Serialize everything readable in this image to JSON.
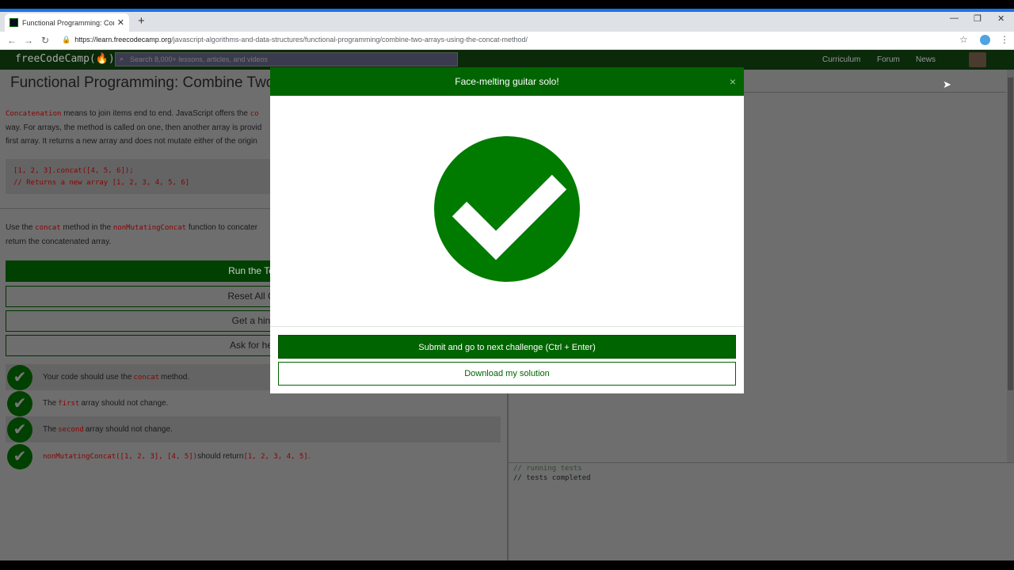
{
  "browser": {
    "tab_title": "Functional Programming: Combi",
    "tab_close": "✕",
    "new_tab": "+",
    "url_host": "https://learn.freecodecamp.org",
    "url_path": "/javascript-algorithms-and-data-structures/functional-programming/combine-two-arrays-using-the-concat-method/"
  },
  "fcc_nav": {
    "logo": "freeCodeCamp(🔥)",
    "search_placeholder": "Search 8,000+ lessons, articles, and videos",
    "links": [
      "Curriculum",
      "Forum",
      "News"
    ]
  },
  "challenge": {
    "title": "Functional Programming: Combine Two",
    "desc_code": "Concatenation",
    "desc_text1": " means to join items end to end. JavaScript offers the ",
    "desc_code2": "co",
    "desc_text2": "way. For arrays, the method is called on one, then another array is provid",
    "desc_text3": "first array. It returns a new array and does not mutate either of the origin",
    "code_line1": "[1, 2, 3].concat([4, 5, 6]);",
    "code_line2": "// Returns a new array [1, 2, 3, 4, 5, 6]",
    "instr_pre": "Use the ",
    "instr_code1": "concat",
    "instr_mid": " method in the ",
    "instr_code2": "nonMutatingConcat",
    "instr_post": " function to concater",
    "instr_line2": "return the concatenated array.",
    "buttons": {
      "run": "Run the Te",
      "reset": "Reset All C",
      "hint": "Get a hin",
      "help": "Ask for he"
    },
    "tests": [
      {
        "pre": "Your code should use the ",
        "code": "concat",
        "post": " method."
      },
      {
        "pre": "The ",
        "code": "first",
        "post": " array should not change."
      },
      {
        "pre": "The ",
        "code": "second",
        "post": " array should not change."
      },
      {
        "pre": "",
        "code": "nonMutatingConcat([1, 2, 3], [4, 5])",
        "post": " should return ",
        "code2": "[1, 2, 3, 4, 5]",
        "end": "."
      }
    ]
  },
  "console": {
    "line1": "// running tests",
    "line2": "// tests completed"
  },
  "modal": {
    "title": "Face-melting guitar solo!",
    "close": "×",
    "submit": "Submit and go to next challenge (Ctrl + Enter)",
    "download": "Download my solution"
  },
  "colors": {
    "fcc_green": "#006400",
    "check_green": "#007b00"
  }
}
